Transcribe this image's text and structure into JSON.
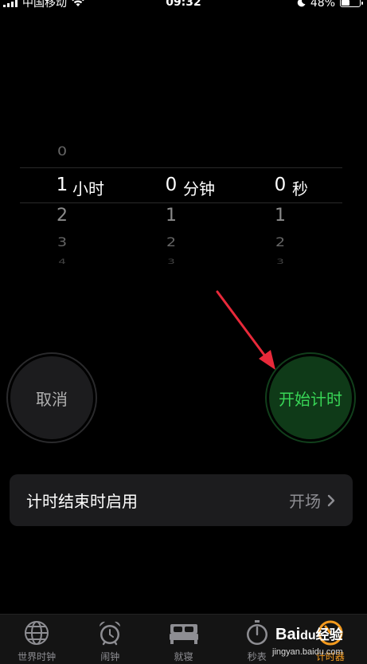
{
  "status_bar": {
    "carrier": "中国移动",
    "time": "09:32",
    "battery": "48%",
    "battery_level": 0.48
  },
  "picker": {
    "hours": {
      "above": "0",
      "selected": "1",
      "below": [
        "2",
        "3",
        "4"
      ],
      "unit": "小时"
    },
    "minutes": {
      "selected": "0",
      "below": [
        "1",
        "2",
        "3"
      ],
      "unit": "分钟"
    },
    "seconds": {
      "selected": "0",
      "below": [
        "1",
        "2",
        "3"
      ],
      "unit": "秒"
    }
  },
  "buttons": {
    "cancel": "取消",
    "start": "开始计时"
  },
  "option": {
    "label": "计时结束时启用",
    "value": "开场"
  },
  "tabs": [
    {
      "label": "世界时钟",
      "icon": "globe-icon"
    },
    {
      "label": "闹钟",
      "icon": "alarm-clock-icon"
    },
    {
      "label": "就寝",
      "icon": "bed-icon"
    },
    {
      "label": "秒表",
      "icon": "stopwatch-icon"
    },
    {
      "label": "计时器",
      "icon": "timer-icon",
      "active": true
    }
  ],
  "watermark": {
    "logo": "Bai",
    "logo_du": "du",
    "logo_tail": "经验",
    "site": "jingyan.baidu.com"
  },
  "colors": {
    "start_text": "#38d556",
    "start_bg": "#0f3a18",
    "active_tab": "#f39a1e",
    "arrow": "#e8293a"
  }
}
